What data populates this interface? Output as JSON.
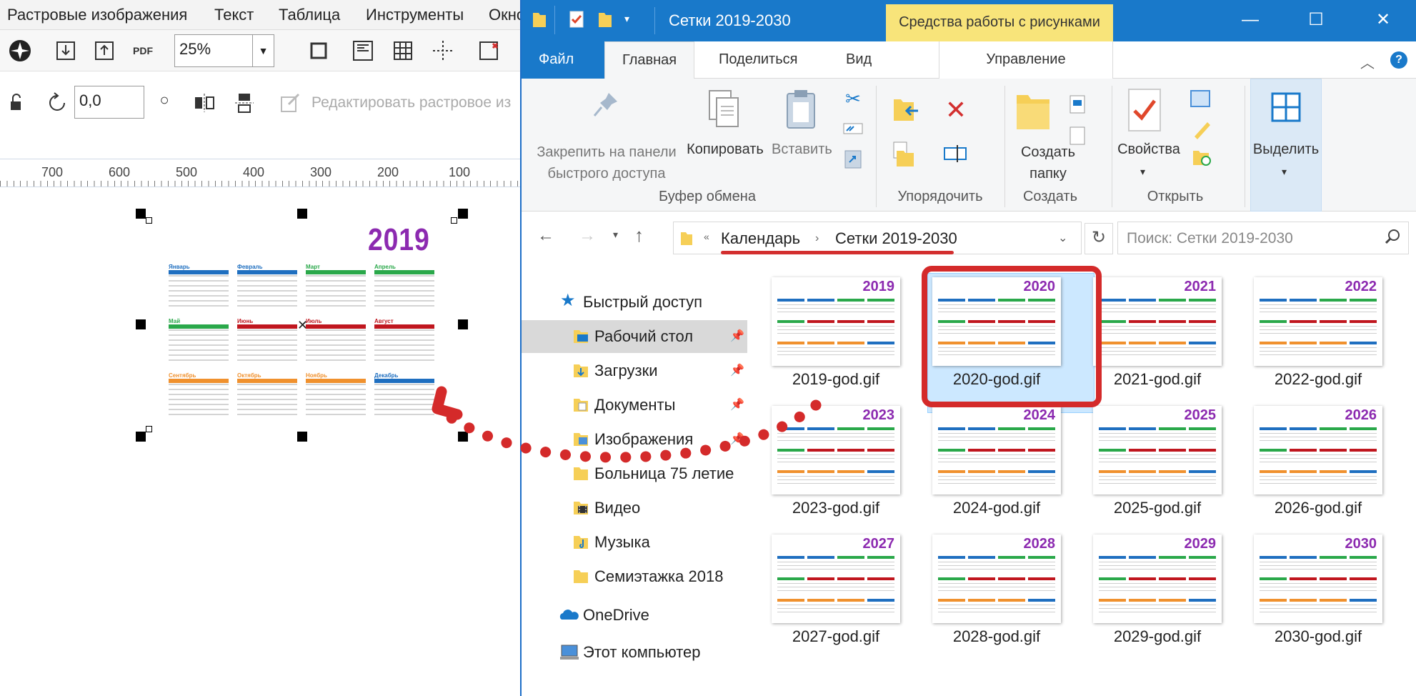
{
  "corel": {
    "menu": [
      "Растровые изображения",
      "Текст",
      "Таблица",
      "Инструменты",
      "Окно"
    ],
    "zoom": "25%",
    "rotation": "0,0",
    "edit_bitmap": "Редактировать растровое из",
    "ruler_ticks": [
      "700",
      "600",
      "500",
      "400",
      "300",
      "200",
      "100"
    ],
    "calendar": {
      "year": "2019",
      "months": [
        "Январь",
        "Февраль",
        "Март",
        "Апрель",
        "Май",
        "Июнь",
        "Июль",
        "Август",
        "Сентябрь",
        "Октябрь",
        "Ноябрь",
        "Декабрь"
      ],
      "month_colors": [
        "#1f6fc0",
        "#1f6fc0",
        "#2aa84a",
        "#2aa84a",
        "#2aa84a",
        "#c0161e",
        "#c0161e",
        "#c0161e",
        "#f0912e",
        "#f0912e",
        "#f0912e",
        "#1f6fc0"
      ]
    }
  },
  "explorer": {
    "title": "Сетки 2019-2030",
    "context_tab": "Средства работы с рисунками",
    "tabs": {
      "file": "Файл",
      "home": "Главная",
      "share": "Поделиться",
      "view": "Вид",
      "manage": "Управление"
    },
    "ribbon": {
      "pin": "Закрепить на панели быстрого доступа",
      "copy": "Копировать",
      "paste": "Вставить",
      "group_clipboard": "Буфер обмена",
      "group_organize": "Упорядочить",
      "new_folder": "Создать папку",
      "group_new": "Создать",
      "properties": "Свойства",
      "group_open": "Открыть",
      "select": "Выделить"
    },
    "breadcrumb": [
      "Календарь",
      "Сетки 2019-2030"
    ],
    "search_placeholder": "Поиск: Сетки 2019-2030",
    "nav": [
      {
        "label": "Быстрый доступ",
        "icon": "star-icon",
        "pinned": false
      },
      {
        "label": "Рабочий стол",
        "icon": "folder-icon",
        "pinned": true
      },
      {
        "label": "Загрузки",
        "icon": "downloads-folder-icon",
        "pinned": true
      },
      {
        "label": "Документы",
        "icon": "documents-folder-icon",
        "pinned": true
      },
      {
        "label": "Изображения",
        "icon": "pictures-folder-icon",
        "pinned": true
      },
      {
        "label": "Больница 75 летие",
        "icon": "folder-icon",
        "pinned": false
      },
      {
        "label": "Видео",
        "icon": "video-folder-icon",
        "pinned": false
      },
      {
        "label": "Музыка",
        "icon": "music-folder-icon",
        "pinned": false
      },
      {
        "label": "Семиэтажка 2018",
        "icon": "folder-icon",
        "pinned": false
      },
      {
        "label": "OneDrive",
        "icon": "onedrive-icon",
        "pinned": false
      },
      {
        "label": "Этот компьютер",
        "icon": "computer-icon",
        "pinned": false
      }
    ],
    "files": [
      {
        "name": "2019-god.gif",
        "year": "2019"
      },
      {
        "name": "2020-god.gif",
        "year": "2020"
      },
      {
        "name": "2021-god.gif",
        "year": "2021"
      },
      {
        "name": "2022-god.gif",
        "year": "2022"
      },
      {
        "name": "2023-god.gif",
        "year": "2023"
      },
      {
        "name": "2024-god.gif",
        "year": "2024"
      },
      {
        "name": "2025-god.gif",
        "year": "2025"
      },
      {
        "name": "2026-god.gif",
        "year": "2026"
      },
      {
        "name": "2027-god.gif",
        "year": "2027"
      },
      {
        "name": "2028-god.gif",
        "year": "2028"
      },
      {
        "name": "2029-god.gif",
        "year": "2029"
      },
      {
        "name": "2030-god.gif",
        "year": "2030"
      }
    ]
  }
}
